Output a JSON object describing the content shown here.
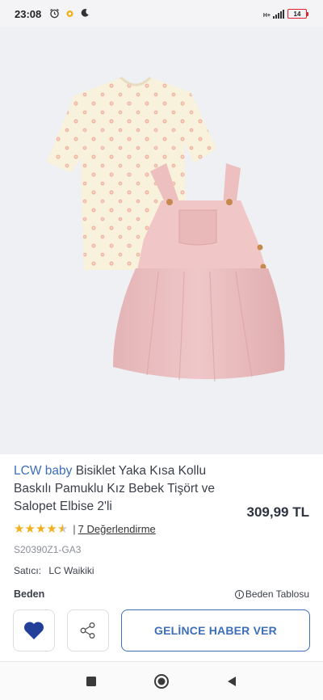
{
  "status_bar": {
    "time": "23:08",
    "battery": "14",
    "network": "H+"
  },
  "product": {
    "brand": "LCW baby",
    "name": "Bisiklet Yaka Kısa Kollu Baskılı Pamuklu Kız Bebek Tişört ve Salopet Elbise 2'li",
    "price": "309,99 TL",
    "rating": 4.5,
    "rating_sep": "|",
    "reviews_link": "7 Değerlendirme",
    "sku": "S20390Z1-GA3",
    "seller_label": "Satıcı:",
    "seller_name": "LC Waikiki"
  },
  "size": {
    "label": "Beden",
    "chart_link": "Beden Tablosu"
  },
  "actions": {
    "notify_label": "GELİNCE HABER VER"
  },
  "colors": {
    "brand": "#3c6fb6",
    "star": "#f2b01e",
    "heart": "#22409a"
  },
  "icons": [
    "alarm-icon",
    "notification-icon",
    "moon-icon",
    "signal-icon",
    "battery-icon",
    "star-icon",
    "info-icon",
    "heart-icon",
    "share-icon",
    "square-icon",
    "circle-icon",
    "back-icon"
  ]
}
